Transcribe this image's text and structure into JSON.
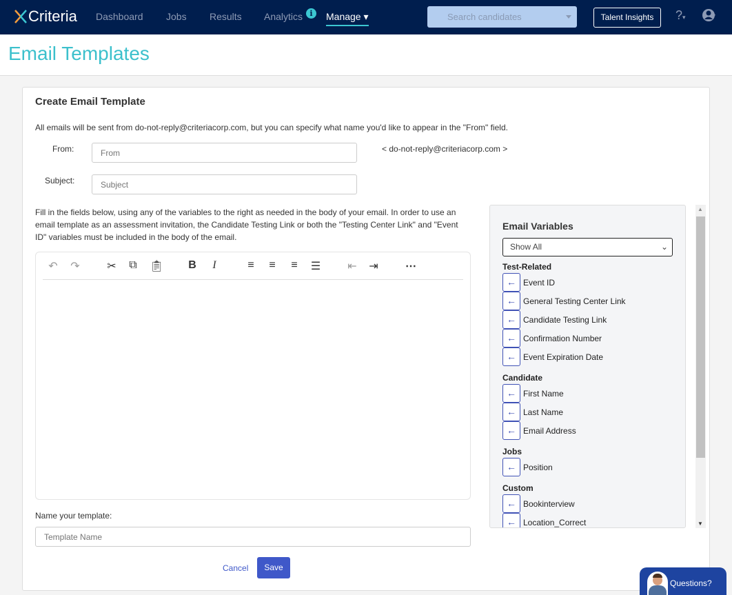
{
  "nav": {
    "logo": "Criteria",
    "links": [
      "Dashboard",
      "Jobs",
      "Results",
      "Analytics"
    ],
    "active": "Manage",
    "search_placeholder": "Search candidates",
    "talent_insights": "Talent Insights"
  },
  "page": {
    "title": "Email Templates"
  },
  "form": {
    "heading": "Create Email Template",
    "intro": "All emails will be sent from do-not-reply@criteriacorp.com, but you can specify what name you'd like to appear in the \"From\" field.",
    "from_label": "From:",
    "from_placeholder": "From",
    "from_suffix": "< do-not-reply@criteriacorp.com >",
    "subject_label": "Subject:",
    "subject_placeholder": "Subject",
    "instructions": "Fill in the fields below, using any of the variables to the right as needed in the body of your email. In order to use an email template as an assessment invitation, the Candidate Testing Link or both the \"Testing Center Link\" and \"Event ID\" variables must be included in the body of the email.",
    "name_label": "Name your template:",
    "name_placeholder": "Template Name",
    "cancel": "Cancel",
    "save": "Save"
  },
  "variables": {
    "title": "Email Variables",
    "filter": "Show All",
    "groups": [
      {
        "name": "Test-Related",
        "items": [
          "Event ID",
          "General Testing Center Link",
          "Candidate Testing Link",
          "Confirmation Number",
          "Event Expiration Date"
        ]
      },
      {
        "name": "Candidate",
        "items": [
          "First Name",
          "Last Name",
          "Email Address"
        ]
      },
      {
        "name": "Jobs",
        "items": [
          "Position"
        ]
      },
      {
        "name": "Custom",
        "items": [
          "Bookinterview",
          "Location_Correct"
        ]
      }
    ]
  },
  "chat": {
    "label": "Questions?"
  },
  "colors": {
    "nav": "#001e4e",
    "accent": "#3cc7d2",
    "primary": "#3f58c9"
  }
}
